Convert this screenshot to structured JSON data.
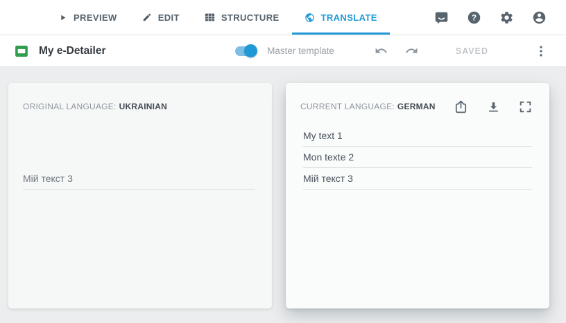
{
  "topnav": {
    "tabs": [
      {
        "label": "PREVIEW",
        "icon": "play-icon",
        "active": false
      },
      {
        "label": "EDIT",
        "icon": "pencil-icon",
        "active": false
      },
      {
        "label": "STRUCTURE",
        "icon": "structure-grid-icon",
        "active": false
      },
      {
        "label": "TRANSLATE",
        "icon": "globe-icon",
        "active": true
      }
    ],
    "actions": [
      {
        "name": "feedback",
        "icon": "chat-bubble-icon"
      },
      {
        "name": "help",
        "icon": "question-circle-icon"
      },
      {
        "name": "settings",
        "icon": "gear-icon"
      },
      {
        "name": "account",
        "icon": "person-circle-icon"
      }
    ]
  },
  "toolbar": {
    "document_title": "My e-Detailer",
    "document_icon": "green-slide-icon",
    "master_template_label": "Master template",
    "master_template_on": true,
    "save_status": "SAVED"
  },
  "original_panel": {
    "label": "ORIGINAL LANGUAGE:",
    "language": "UKRAINIAN",
    "texts": [
      "Мій текст 3"
    ]
  },
  "current_panel": {
    "label": "CURRENT LANGUAGE:",
    "language": "GERMAN",
    "header_icons": [
      "share-icon",
      "download-icon",
      "fullscreen-icon"
    ],
    "texts": [
      "My text 1",
      "Mon texte 2",
      "Мій текст 3"
    ]
  },
  "colors": {
    "accent_blue": "#1f99d6",
    "brand_green": "#2f9e4e",
    "toggle_track_blue": "#7bbfe7",
    "workspace_background": "#ecedee",
    "icon_slate": "#57636d"
  }
}
